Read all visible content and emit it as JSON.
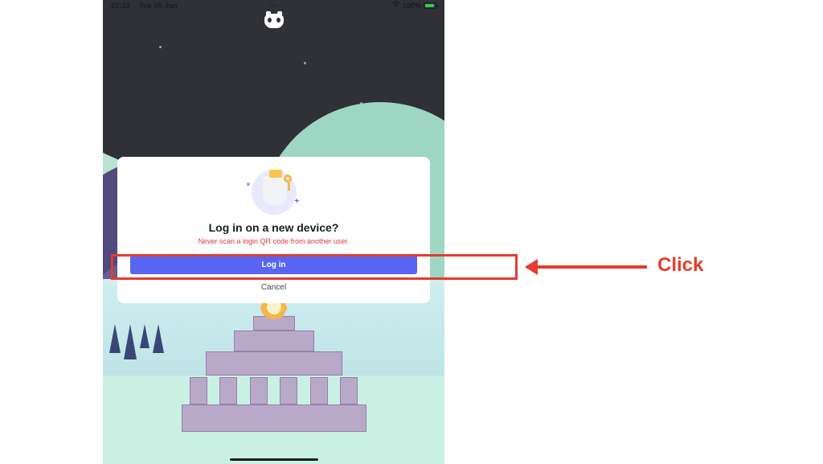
{
  "status_bar": {
    "time": "22:23",
    "date": "Tue 08 Jun",
    "battery_text": "100%",
    "icons": {
      "wifi": "wifi-icon",
      "battery": "battery-icon"
    }
  },
  "app": {
    "name": "Discord",
    "logo_icon": "discord-logo-icon"
  },
  "modal": {
    "title": "Log in on a new device?",
    "warning": "Never scan a login QR code from another user.",
    "login_label": "Log in",
    "cancel_label": "Cancel"
  },
  "annotation": {
    "label": "Click",
    "target": "login-button"
  }
}
